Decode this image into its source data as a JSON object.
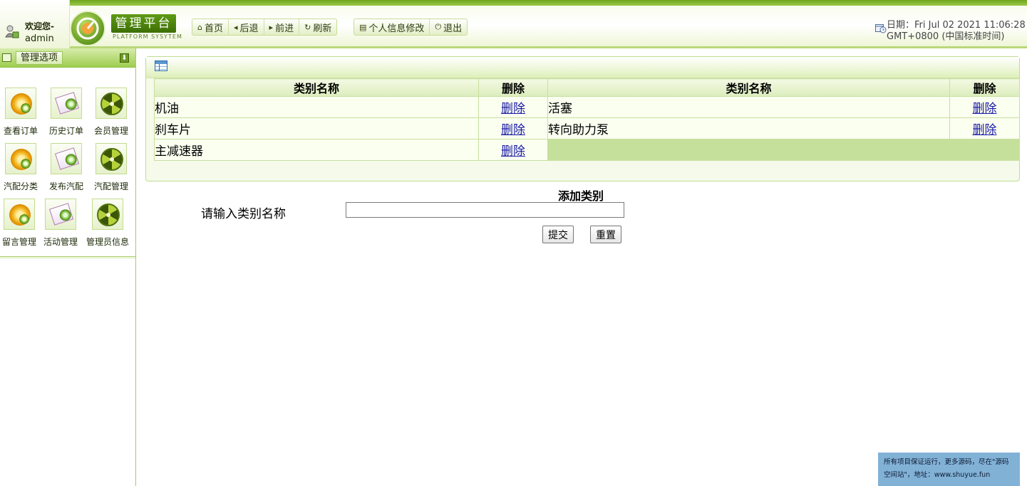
{
  "header": {
    "welcome": "欢迎您-",
    "username": "admin",
    "logo_title": "管理平台",
    "logo_subtitle": "PLATFORM SYSYTEM",
    "nav": [
      {
        "label": "首页",
        "icon": "home-icon"
      },
      {
        "label": "后退",
        "icon": "back-arrow-icon"
      },
      {
        "label": "前进",
        "icon": "forward-arrow-icon"
      },
      {
        "label": "刷新",
        "icon": "refresh-icon"
      }
    ],
    "nav2": [
      {
        "label": "个人信息修改",
        "icon": "document-icon"
      },
      {
        "label": "退出",
        "icon": "power-icon"
      }
    ],
    "date_line1": "日期：Fri Jul 02 2021 11:06:28",
    "date_line2": "GMT+0800 (中国标准时间)"
  },
  "sidebar": {
    "title": "管理选项",
    "items": [
      {
        "label": "查看订单",
        "icon": "gear-icon"
      },
      {
        "label": "历史订单",
        "icon": "paper-icon"
      },
      {
        "label": "会员管理",
        "icon": "radioactive-icon"
      },
      {
        "label": "汽配分类",
        "icon": "gear-icon"
      },
      {
        "label": "发布汽配",
        "icon": "paper-icon"
      },
      {
        "label": "汽配管理",
        "icon": "radioactive-icon"
      },
      {
        "label": "留言管理",
        "icon": "gear-icon"
      },
      {
        "label": "活动管理",
        "icon": "paper-icon"
      },
      {
        "label": "管理员信息",
        "icon": "radioactive-icon"
      }
    ]
  },
  "table": {
    "headers": [
      "类别名称",
      "删除",
      "类别名称",
      "删除"
    ],
    "delete_label": "删除",
    "rows": [
      [
        "机油",
        "活塞"
      ],
      [
        "刹车片",
        "转向助力泵"
      ],
      [
        "主减速器",
        ""
      ]
    ]
  },
  "form": {
    "title": "添加类别",
    "label": "请输入类别名称",
    "value": "",
    "submit": "提交",
    "reset": "重置"
  },
  "watermark": {
    "line1": "所有项目保证运行，更多源码，尽在\"源码",
    "line2": "空间站\"，地址：www.shuyue.fun"
  }
}
